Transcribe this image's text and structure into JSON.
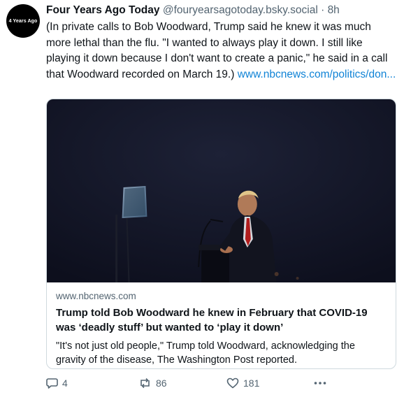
{
  "author": {
    "avatar_text": "4 Years Ago",
    "display_name": "Four Years Ago Today",
    "handle": "@fouryearsagotoday.bsky.social",
    "separator": "·",
    "time": "8h"
  },
  "post": {
    "text": "(In private calls to Bob Woodward, Trump said he knew it was much more lethal than the flu. \"I wanted to always play it down. I still like playing it down because I don't want to create a panic,\" he said in a call that Woodward recorded on March 19.) ",
    "link_text": "www.nbcnews.com/politics/don..."
  },
  "card": {
    "domain": "www.nbcnews.com",
    "title": "Trump told Bob Woodward he knew in February that COVID-19 was ‘deadly stuff’ but wanted to ‘play it down’",
    "description": "\"It's not just old people,\" Trump told Woodward, acknowledging the gravity of the disease, The Washington Post reported."
  },
  "actions": {
    "reply_count": "4",
    "repost_count": "86",
    "like_count": "181",
    "reply_icon": "speech-bubble-icon",
    "repost_icon": "repost-arrows-icon",
    "like_icon": "heart-icon",
    "more_icon": "ellipsis-icon"
  },
  "colors": {
    "link": "#1083d6",
    "secondary_text": "#536471",
    "image_background": "#14172a"
  }
}
